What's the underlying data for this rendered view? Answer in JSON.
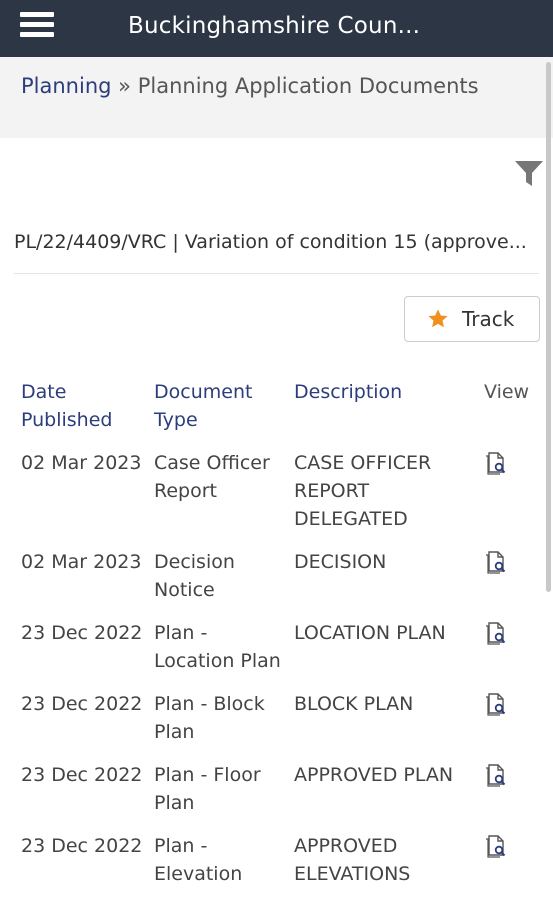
{
  "header": {
    "title": "Buckinghamshire Coun...",
    "menu_icon": "hamburger-menu-icon"
  },
  "breadcrumb": {
    "link": "Planning",
    "separator": "»",
    "current": "Planning Application Documents"
  },
  "filter": {
    "icon": "filter-icon"
  },
  "application": {
    "reference": "PL/22/4409/VRC | Variation of condition 15 (approve..."
  },
  "track": {
    "label": "Track",
    "icon": "star-icon",
    "icon_color": "#f0911f"
  },
  "table": {
    "headers": {
      "date": "Date Published",
      "type": "Document Type",
      "description": "Description",
      "view": "View"
    },
    "rows": [
      {
        "date": "02 Mar 2023",
        "type": "Case Officer Report",
        "description": "CASE OFFICER REPORT DELEGATED"
      },
      {
        "date": "02 Mar 2023",
        "type": "Decision Notice",
        "description": "DECISION"
      },
      {
        "date": "23 Dec 2022",
        "type": "Plan - Location Plan",
        "description": "LOCATION PLAN"
      },
      {
        "date": "23 Dec 2022",
        "type": "Plan - Block Plan",
        "description": "BLOCK PLAN"
      },
      {
        "date": "23 Dec 2022",
        "type": "Plan - Floor Plan",
        "description": "APPROVED PLAN"
      },
      {
        "date": "23 Dec 2022",
        "type": "Plan - Elevation",
        "description": "APPROVED ELEVATIONS"
      }
    ]
  },
  "colors": {
    "header_bg": "#2d3644",
    "link": "#2c3d7c",
    "breadcrumb_bg": "#f3f3f3"
  }
}
